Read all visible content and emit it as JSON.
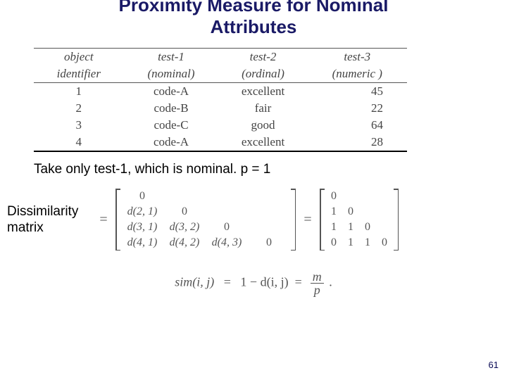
{
  "title_l1": "Proximity Measure for Nominal",
  "title_l2": "Attributes",
  "table": {
    "h": {
      "c1a": "object",
      "c1b": "identifier",
      "c2a": "test-1",
      "c2b": "(nominal)",
      "c3a": "test-2",
      "c3b": "(ordinal)",
      "c4a": "test-3",
      "c4b": "(numeric )"
    },
    "r": [
      {
        "id": "1",
        "t1": "code-A",
        "t2": "excellent",
        "t3": "45"
      },
      {
        "id": "2",
        "t1": "code-B",
        "t2": "fair",
        "t3": "22"
      },
      {
        "id": "3",
        "t1": "code-C",
        "t2": "good",
        "t3": "64"
      },
      {
        "id": "4",
        "t1": "code-A",
        "t2": "excellent",
        "t3": "28"
      }
    ]
  },
  "caption": "Take only test-1, which is nominal. p = 1",
  "mlabel_l1": "Dissimilarity",
  "mlabel_l2": "matrix",
  "eq": "=",
  "sym": {
    "r0c0": "0",
    "r1c0": "d(2, 1)",
    "r1c1": "0",
    "r2c0": "d(3, 1)",
    "r2c1": "d(3, 2)",
    "r2c2": "0",
    "r3c0": "d(4, 1)",
    "r3c1": "d(4, 2)",
    "r3c2": "d(4, 3)",
    "r3c3": "0"
  },
  "num": {
    "r0c0": "0",
    "r1c0": "1",
    "r1c1": "0",
    "r2c0": "1",
    "r2c1": "1",
    "r2c2": "0",
    "r3c0": "0",
    "r3c1": "1",
    "r3c2": "1",
    "r3c3": "0"
  },
  "sim": {
    "lhs": "sim(i, j)",
    "mid": "1 − d(i, j)",
    "frac_t": "m",
    "frac_b": "p",
    "dot": "."
  },
  "page": "61"
}
